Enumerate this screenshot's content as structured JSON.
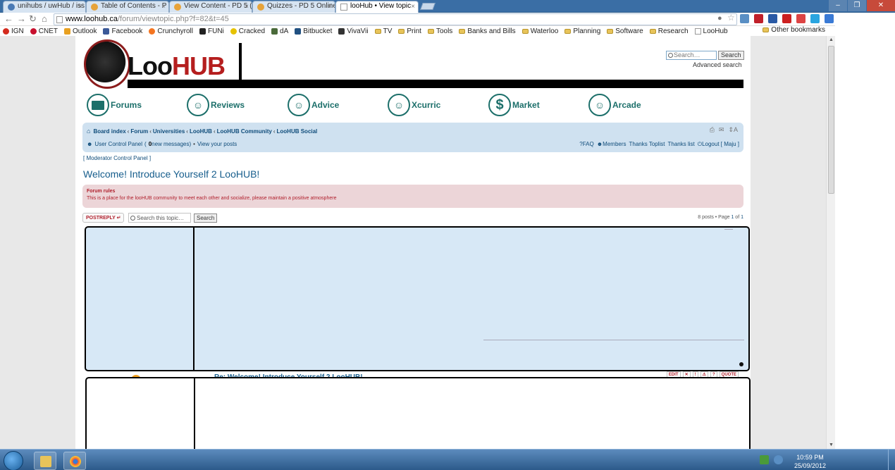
{
  "browser": {
    "tabs": [
      {
        "title": "unihubs / uwHub / iss",
        "active": false
      },
      {
        "title": "Table of Contents - P",
        "active": false
      },
      {
        "title": "View Content - PD 5 (",
        "active": false
      },
      {
        "title": "Quizzes - PD 5 Online",
        "active": false
      },
      {
        "title": "looHub • View topic",
        "active": true
      }
    ],
    "url_host": "www.loohub.ca",
    "url_path": "/forum/viewtopic.php?f=82&t=45",
    "bookmarks": [
      {
        "label": "IGN",
        "icon": "ign-icon",
        "color": "#d42b1e"
      },
      {
        "label": "CNET",
        "icon": "cnet-icon",
        "color": "#c8102e"
      },
      {
        "label": "Outlook",
        "icon": "outlook-icon",
        "color": "#e8a020"
      },
      {
        "label": "Facebook",
        "icon": "facebook-icon",
        "color": "#3b5998"
      },
      {
        "label": "Crunchyroll",
        "icon": "crunchyroll-icon",
        "color": "#f47521"
      },
      {
        "label": "FUNi",
        "icon": "funimation-icon",
        "color": "#222222"
      },
      {
        "label": "Cracked",
        "icon": "cracked-icon",
        "color": "#e6c200"
      },
      {
        "label": "dA",
        "icon": "deviantart-icon",
        "color": "#4a6a3a"
      },
      {
        "label": "Bitbucket",
        "icon": "bitbucket-icon",
        "color": "#205081"
      },
      {
        "label": "VivaVii",
        "icon": "vivavii-icon",
        "color": "#333333"
      },
      {
        "label": "TV",
        "icon": "folder-icon",
        "color": "#e8c45a"
      },
      {
        "label": "Print",
        "icon": "folder-icon",
        "color": "#e8c45a"
      },
      {
        "label": "Tools",
        "icon": "folder-icon",
        "color": "#e8c45a"
      },
      {
        "label": "Banks and Bills",
        "icon": "folder-icon",
        "color": "#e8c45a"
      },
      {
        "label": "Waterloo",
        "icon": "folder-icon",
        "color": "#e8c45a"
      },
      {
        "label": "Planning",
        "icon": "folder-icon",
        "color": "#e8c45a"
      },
      {
        "label": "Software",
        "icon": "folder-icon",
        "color": "#e8c45a"
      },
      {
        "label": "Research",
        "icon": "folder-icon",
        "color": "#e8c45a"
      },
      {
        "label": "LooHub",
        "icon": "page-icon",
        "color": "#ffffff"
      }
    ],
    "other_bookmarks": "Other bookmarks"
  },
  "site": {
    "logo_loo": "Loo",
    "logo_hub": "HUB",
    "search_placeholder": "Search…",
    "search_button": "Search",
    "advanced_search": "Advanced search",
    "nav": [
      {
        "label": "Forums",
        "icon": "folder-icon"
      },
      {
        "label": "Reviews",
        "icon": "reviewer-face-icon"
      },
      {
        "label": "Advice",
        "icon": "advisor-face-icon"
      },
      {
        "label": "Xcurric",
        "icon": "xcurric-face-icon"
      },
      {
        "label": "Market",
        "icon": "dollar-icon"
      },
      {
        "label": "Arcade",
        "icon": "gamer-face-icon"
      }
    ],
    "breadcrumbs": [
      "Board index",
      "Forum",
      "Universities",
      "LooHUB",
      "LooHUB Community",
      "LooHUB Social"
    ],
    "ucp_label": "User Control Panel",
    "ucp_open": "(",
    "new_messages_count": "0",
    "new_messages_label": " new messages)",
    "ucp_sep": "•",
    "view_posts": "View your posts",
    "userlinks": {
      "faq": "FAQ",
      "members": "Members",
      "thanks_toplist": "Thanks Toplist",
      "thanks_list": "Thanks list",
      "logout": "Logout [ Maju ]"
    },
    "mcp": "[ Moderator Control Panel ]",
    "page_title": "Welcome! Introduce Yourself 2 LooHUB!",
    "rules_title": "Forum rules",
    "rules_body": "This is a place for the looHUB community to meet each other and socialize, please maintain a positive atmosphere",
    "post_reply": "POSTREPLY",
    "topic_search_placeholder": "Search this topic…",
    "topic_search_button": "Search",
    "pagination_prefix": "8 posts • Page ",
    "pagination_current": "1",
    "pagination_mid": " of ",
    "pagination_total": "1",
    "post2_title": "Re: Welcome! Introduce Yourself 2 LooHUB!",
    "post_buttons": [
      "EDIT",
      "✕",
      "!",
      "⚠",
      "?",
      "QUOTE"
    ]
  },
  "taskbar": {
    "time": "10:59 PM",
    "date": "25/09/2012"
  }
}
